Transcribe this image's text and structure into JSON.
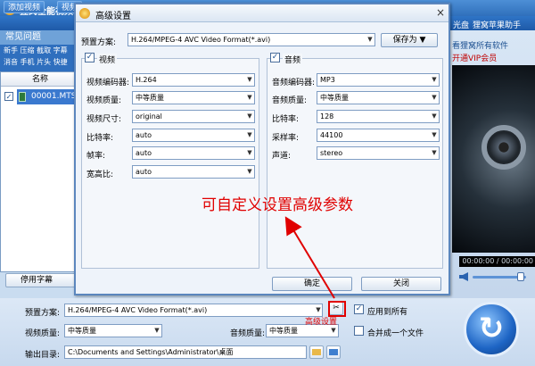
{
  "app": {
    "title": "狸窝全能视频转换器",
    "toolbar_buttons": [
      "添加视频",
      "视频"
    ],
    "right_links": [
      "光盘",
      "狸窝苹果助手"
    ],
    "faq_title": "常见问题",
    "side_links": [
      "新手 压缩 截取 字幕",
      "消音 手机 片头 快捷"
    ],
    "list_header": "名称",
    "file_name": "00001.MTS",
    "file_checked": "✓",
    "subtitle_button": "停用字幕",
    "ad_text": "看狸窝所有软件",
    "ad_vip": "开通VIP会员",
    "time_display": "00:00:00 / 00:00:00"
  },
  "bottom": {
    "preset_label": "预置方案:",
    "preset_value": "H.264/MPEG-4 AVC Video Format(*.avi)",
    "apply_all_label": "应用到所有",
    "apply_all_checked": "✓",
    "video_quality_label": "视频质量:",
    "video_quality_value": "中等质量",
    "audio_quality_label": "音频质量:",
    "audio_quality_value": "中等质量",
    "merge_label": "合并成一个文件",
    "output_label": "输出目录:",
    "output_value": "C:\\Documents and Settings\\Administrator\\桌面",
    "advanced_label": "高级设置"
  },
  "dialog": {
    "title": "高级设置",
    "close": "×",
    "preset_label": "预置方案:",
    "preset_value": "H.264/MPEG-4 AVC Video Format(*.avi)",
    "save_as": "保存为",
    "video_group": "视频",
    "video_checked": "✓",
    "audio_group": "音频",
    "audio_checked": "✓",
    "video_rows": [
      {
        "label": "视频编码器:",
        "value": "H.264"
      },
      {
        "label": "视频质量:",
        "value": "中等质量"
      },
      {
        "label": "视频尺寸:",
        "value": "original"
      },
      {
        "label": "比特率:",
        "value": "auto"
      },
      {
        "label": "帧率:",
        "value": "auto"
      },
      {
        "label": "宽高比:",
        "value": "auto"
      }
    ],
    "audio_rows": [
      {
        "label": "音频编码器:",
        "value": "MP3"
      },
      {
        "label": "音频质量:",
        "value": "中等质量"
      },
      {
        "label": "比特率:",
        "value": "128"
      },
      {
        "label": "采样率:",
        "value": "44100"
      },
      {
        "label": "声道:",
        "value": "stereo"
      }
    ],
    "ok": "确定",
    "close_button": "关闭"
  },
  "annotation": "可自定义设置高级参数",
  "colors": {
    "accent": "#2f6fbe",
    "annotation": "#e00000"
  }
}
